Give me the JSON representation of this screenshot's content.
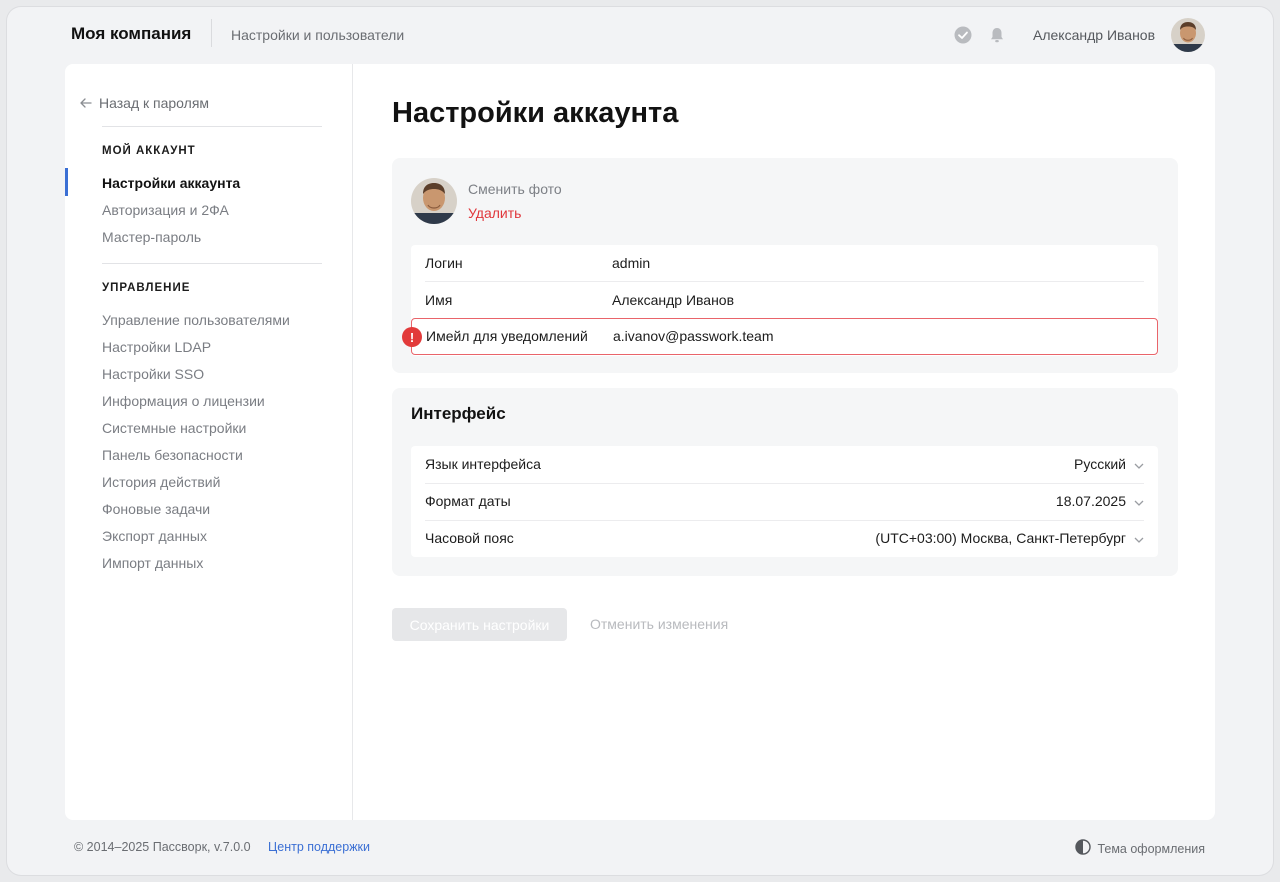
{
  "header": {
    "company": "Моя компания",
    "section": "Настройки и пользователи",
    "user_name": "Александр Иванов",
    "icons": [
      "check-circle-icon",
      "bell-icon"
    ]
  },
  "sidebar": {
    "back_label": "Назад к паролям",
    "groups": [
      {
        "title": "МОЙ АККАУНТ",
        "items": [
          {
            "label": "Настройки аккаунта",
            "active": true
          },
          {
            "label": "Авторизация и 2ФА"
          },
          {
            "label": "Мастер-пароль"
          }
        ]
      },
      {
        "title": "УПРАВЛЕНИЕ",
        "items": [
          {
            "label": "Управление пользователями"
          },
          {
            "label": "Настройки LDAP"
          },
          {
            "label": "Настройки SSO"
          },
          {
            "label": "Информация о лицензии"
          },
          {
            "label": "Системные настройки"
          },
          {
            "label": "Панель безопасности"
          },
          {
            "label": "История действий"
          },
          {
            "label": "Фоновые задачи"
          },
          {
            "label": "Экспорт данных"
          },
          {
            "label": "Импорт данных"
          }
        ]
      }
    ]
  },
  "main": {
    "title": "Настройки аккаунта",
    "profile": {
      "change_photo": "Сменить фото",
      "delete_photo": "Удалить",
      "fields": [
        {
          "label": "Логин",
          "value": "admin"
        },
        {
          "label": "Имя",
          "value": "Александр Иванов"
        },
        {
          "label": "Имейл для уведомлений",
          "value": "a.ivanov@passwork.team",
          "error": true
        }
      ]
    },
    "interface": {
      "title": "Интерфейс",
      "settings": [
        {
          "label": "Язык интерфейса",
          "value": "Русский"
        },
        {
          "label": "Формат даты",
          "value": "18.07.2025"
        },
        {
          "label": "Часовой пояс",
          "value": "(UTC+03:00) Москва, Санкт-Петербург"
        }
      ]
    },
    "save_label": "Сохранить настройки",
    "cancel_label": "Отменить изменения"
  },
  "footer": {
    "copyright": "© 2014–2025 Пассворк, v.7.0.0",
    "support": "Центр поддержки",
    "theme": "Тема оформления"
  },
  "colors": {
    "accent": "#3b6fd4",
    "danger": "#e0373b",
    "error_border": "#e9646a"
  }
}
